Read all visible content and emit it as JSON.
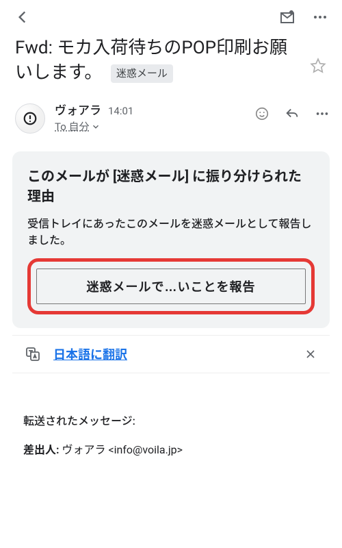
{
  "subject": "Fwd: モカ入荷待ちのPOP印刷お願いします。",
  "spam_badge": "迷惑メール",
  "sender": {
    "name": "ヴォアラ",
    "time": "14:01",
    "to_line": "To 自分"
  },
  "spam_card": {
    "title": "このメールが [迷惑メール] に振り分けられた理由",
    "desc": "受信トレイにあったこのメールを迷惑メールとして報告しました。",
    "button": "迷惑メールで…いことを報告"
  },
  "translate": {
    "label": "日本語に翻訳"
  },
  "forwarded": {
    "heading": "転送されたメッセージ:",
    "from_label": "差出人:",
    "from_value": " ヴォアラ <info@voila.jp>"
  }
}
